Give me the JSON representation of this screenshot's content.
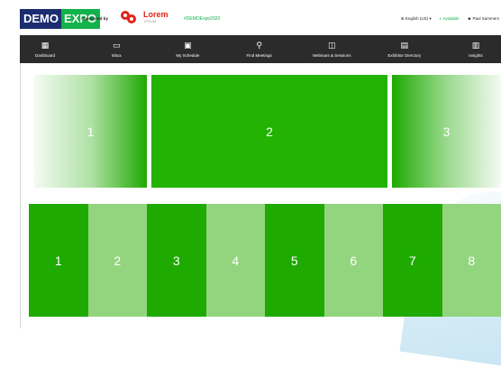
{
  "header": {
    "logo_demo": "DEMO",
    "logo_expo": "EXPO",
    "sponsored_by": "Sponsored by",
    "sponsor_name": "Lorem",
    "sponsor_sub": "IPSUM",
    "hashtag": "#DEMOExpo2020",
    "language": "⊕ English (US) ▾",
    "availability": "◐ Available",
    "user": "☻ Paul Summers"
  },
  "nav": {
    "items": [
      {
        "icon": "dashboard-icon",
        "glyph": "▦",
        "label": "Dashboard"
      },
      {
        "icon": "inbox-icon",
        "glyph": "▭",
        "label": "Inbox"
      },
      {
        "icon": "calendar-icon",
        "glyph": "▣",
        "label": "My Schedule"
      },
      {
        "icon": "search-icon",
        "glyph": "⚲",
        "label": "Find Meetings"
      },
      {
        "icon": "video-icon",
        "glyph": "◫",
        "label": "Webinars & Sessions"
      },
      {
        "icon": "directory-icon",
        "glyph": "▤",
        "label": "Exhibitor Directory"
      },
      {
        "icon": "insights-icon",
        "glyph": "▥",
        "label": "Insights"
      }
    ]
  },
  "carousel_top": {
    "slides": [
      "1",
      "2",
      "3"
    ]
  },
  "carousel_bottom": {
    "slides": [
      "1",
      "2",
      "3",
      "4",
      "5",
      "6",
      "7",
      "8"
    ]
  },
  "colors": {
    "brand_navy": "#1c2d6f",
    "brand_green": "#12b24a",
    "tile_green": "#1faa02",
    "tile_light_green": "#93d57e",
    "nav_bg": "#2b2b2b"
  }
}
